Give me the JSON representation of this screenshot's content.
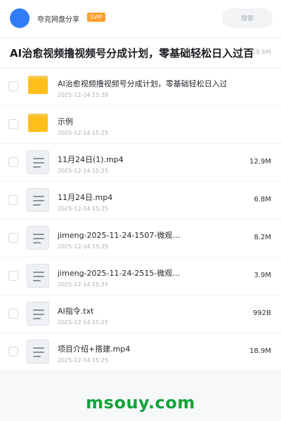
{
  "header": {
    "user_name": "夸克网盘分享",
    "badge": "SVIP",
    "search_placeholder": "搜索"
  },
  "title_bar": {
    "title": "AI治愈视频撸视频号分成计划，零基础轻松日入过百",
    "total_size": "19.6M"
  },
  "files": [
    {
      "type": "folder",
      "name": "AI治愈视频撸视频号分成计划，零基础轻松日入过百",
      "date": "2025-12-14 15:28",
      "size": ""
    },
    {
      "type": "folder",
      "name": "示例",
      "date": "2025-12-14 15:25",
      "size": ""
    },
    {
      "type": "file",
      "name": "11月24日(1).mp4",
      "date": "2025-12-14 15:25",
      "size": "12.9M"
    },
    {
      "type": "file",
      "name": "11月24日.mp4",
      "date": "2025-12-14 15:25",
      "size": "6.8M"
    },
    {
      "type": "file",
      "name": "jimeng-2025-11-24-1507-微观…",
      "date": "2025-12-14 15:25",
      "size": "8.2M"
    },
    {
      "type": "file",
      "name": "jimeng-2025-11-24-2515-微观…",
      "date": "2025-12-14 15:25",
      "size": "3.9M"
    },
    {
      "type": "file",
      "name": "AI指令.txt",
      "date": "2025-12-14 15:25",
      "size": "992B"
    },
    {
      "type": "file",
      "name": "项目介绍+搭建.mp4",
      "date": "2025-12-14 15:25",
      "size": "18.9M"
    }
  ],
  "watermark": "msouy.com",
  "colors": {
    "accent_blue": "#2f7cf6",
    "svip_orange": "#ff9c29",
    "folder_yellow": "#ffbf19",
    "watermark_green": "#10a33a"
  }
}
